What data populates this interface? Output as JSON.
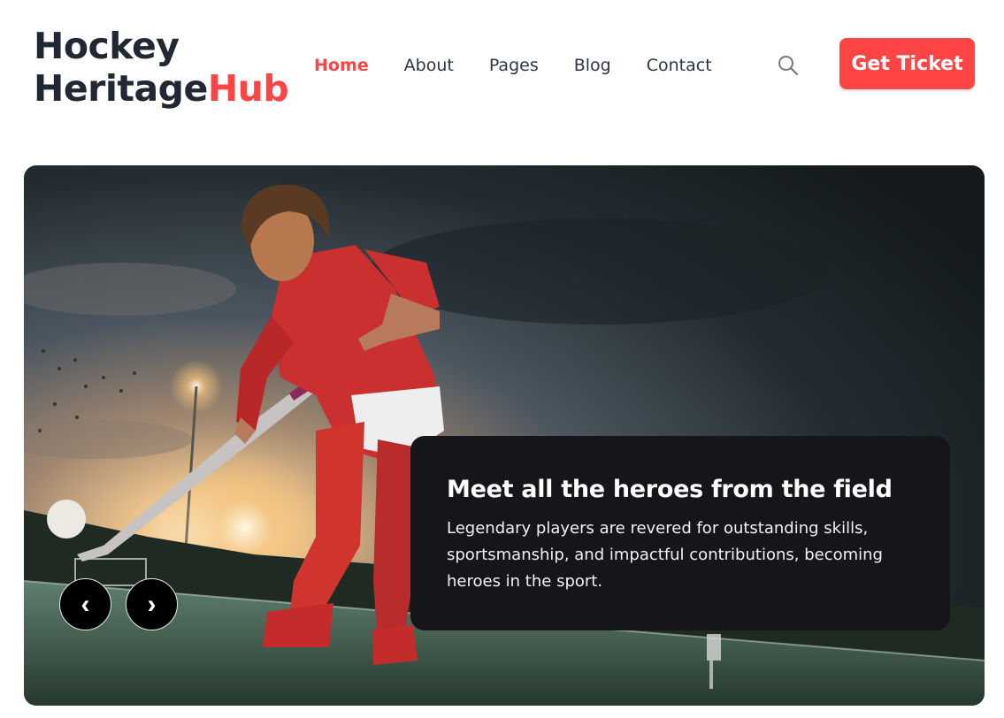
{
  "header": {
    "logo_line1": "Hockey",
    "logo_line2_main": "Heritage",
    "logo_line2_accent": "Hub",
    "nav": [
      "Home",
      "About",
      "Pages",
      "Blog",
      "Contact"
    ],
    "active_nav": "Home",
    "search_icon": "search-icon",
    "ticket_label": "Get Ticket"
  },
  "hero": {
    "title": "Meet all the heroes from the field",
    "description": "Legendary players are revered for outstanding skills, sportsmanship, and impactful contributions, becoming heroes in the sport.",
    "prev_label": "‹",
    "next_label": "›"
  },
  "colors": {
    "accent": "#fe4445",
    "text": "#212733",
    "caption_bg": "#16151a"
  }
}
